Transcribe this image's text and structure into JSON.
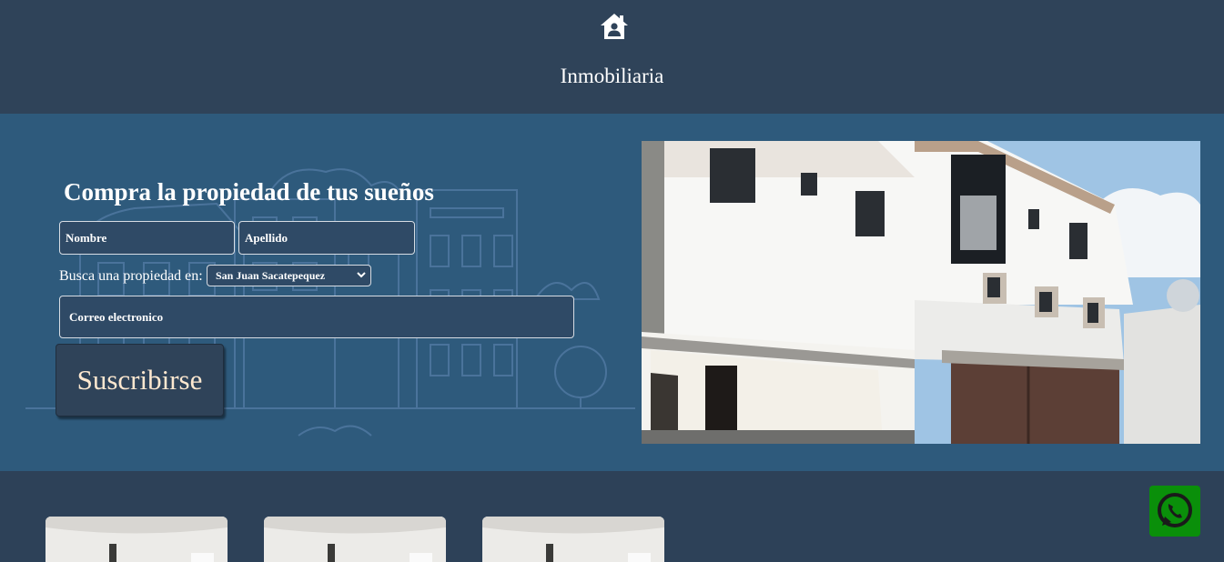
{
  "header": {
    "logo_icon": "house-user-icon",
    "brand": "Inmobiliaria"
  },
  "hero": {
    "title": "Compra la propiedad de tus sueños",
    "form": {
      "nombre_placeholder": "Nombre",
      "apellido_placeholder": "Apellido",
      "busca_label": "Busca una propiedad en:",
      "select_value": "San Juan Sacatepequez",
      "correo_placeholder": "Correo electronico",
      "submit_label": "Suscribirse"
    },
    "background_icon": "city-buildings-illustration",
    "image": "house-photo"
  },
  "cards": [
    {
      "image": "property-photo"
    },
    {
      "image": "property-photo"
    },
    {
      "image": "property-photo"
    }
  ],
  "floating": {
    "whatsapp_icon": "whatsapp-icon"
  },
  "colors": {
    "header_bg": "#2f4359",
    "hero_bg": "#2e5a7c",
    "page_bg": "#2d4158",
    "button_text": "#fde8d0",
    "whatsapp": "#0a8f0a"
  }
}
